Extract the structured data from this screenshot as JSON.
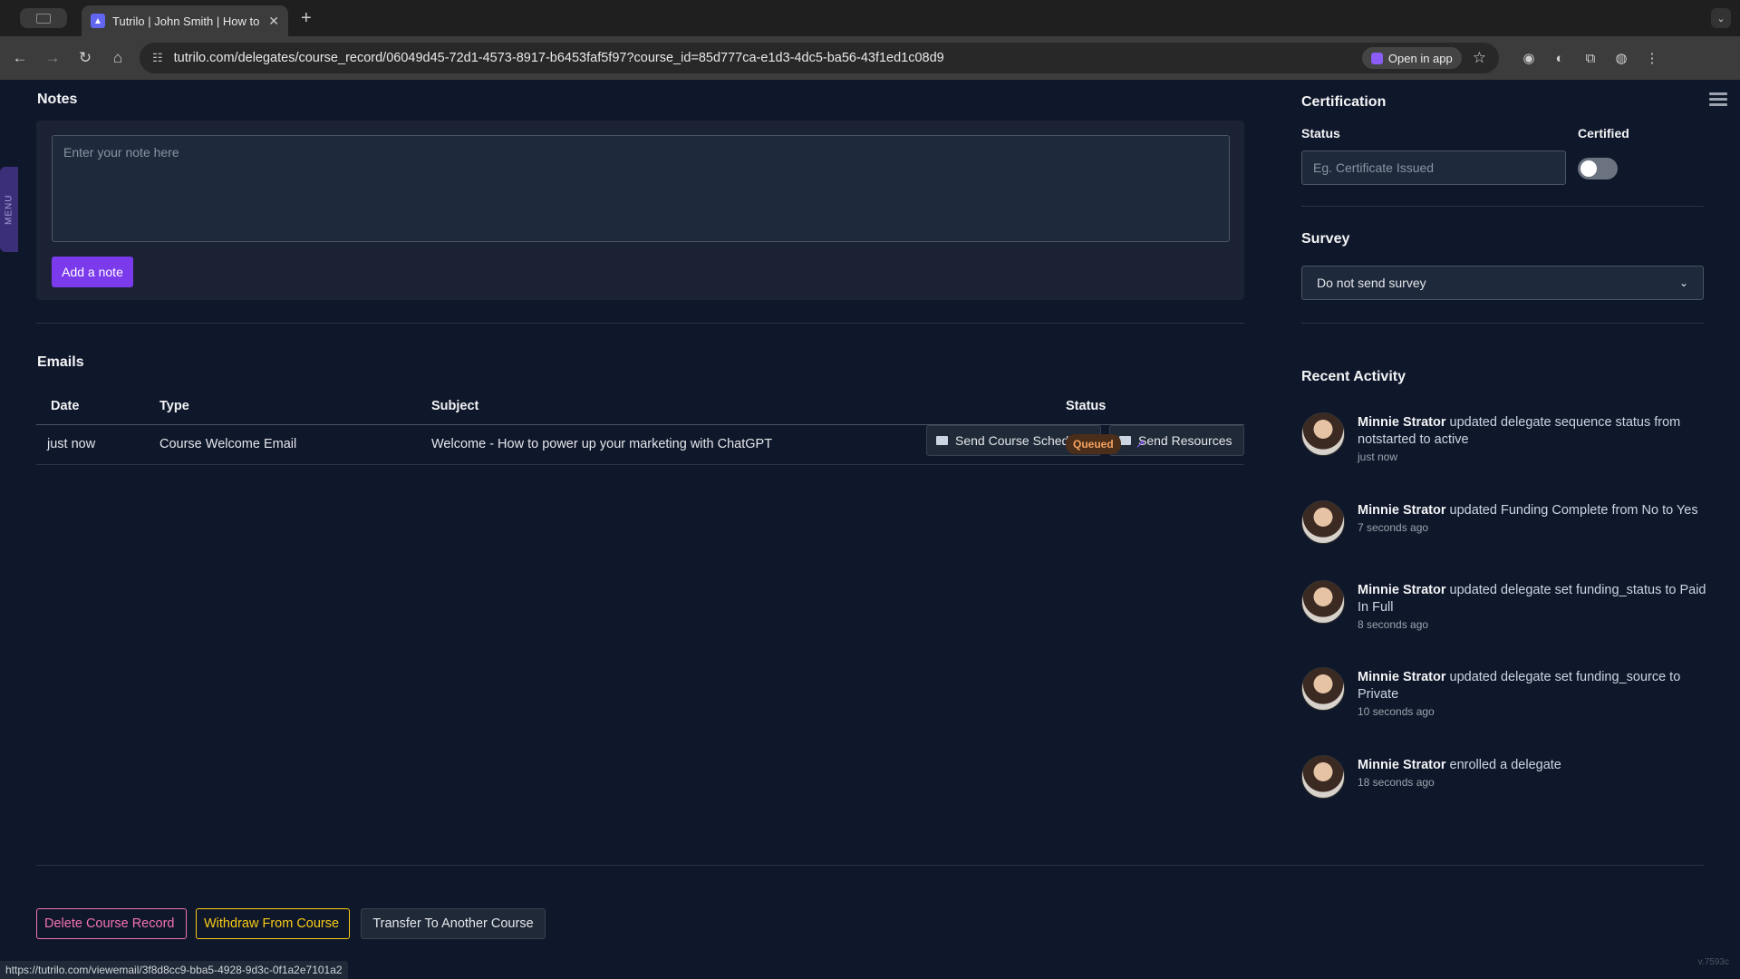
{
  "browser": {
    "tab_title": "Tutrilo | John Smith | How to p",
    "url": "tutrilo.com/delegates/course_record/06049d45-72d1-4573-8917-b6453faf5f97?course_id=85d777ca-e1d3-4dc5-ba56-43f1ed1c08d9",
    "open_in_app": "Open in app",
    "status_url": "https://tutrilo.com/viewemail/3f8d8cc9-bba5-4928-9d3c-0f1a2e7101a2"
  },
  "menu_tab": "MENU",
  "notes": {
    "title": "Notes",
    "placeholder": "Enter your note here",
    "add_button": "Add a note"
  },
  "emails": {
    "title": "Emails",
    "send_schedule": "Send Course Schedule",
    "send_resources": "Send Resources",
    "headers": [
      "Date",
      "Type",
      "Subject",
      "Status"
    ],
    "rows": [
      {
        "date": "just now",
        "type": "Course Welcome Email",
        "subject": "Welcome - How to power up your marketing with ChatGPT",
        "status": "Queued"
      }
    ]
  },
  "actions": {
    "delete": "Delete Course Record",
    "withdraw": "Withdraw From Course",
    "transfer": "Transfer To Another Course"
  },
  "certification": {
    "title": "Certification",
    "status_label": "Status",
    "status_placeholder": "Eg. Certificate Issued",
    "certified_label": "Certified",
    "certified": false
  },
  "survey": {
    "title": "Survey",
    "selected": "Do not send survey"
  },
  "activity": {
    "title": "Recent Activity",
    "items": [
      {
        "who": "Minnie Strator",
        "text": "updated delegate sequence status from notstarted to active",
        "time": "just now"
      },
      {
        "who": "Minnie Strator",
        "text": "updated Funding Complete from No to Yes",
        "time": "7 seconds ago"
      },
      {
        "who": "Minnie Strator",
        "text": "updated delegate set funding_status to Paid In Full",
        "time": "8 seconds ago"
      },
      {
        "who": "Minnie Strator",
        "text": "updated delegate set funding_source to Private",
        "time": "10 seconds ago"
      },
      {
        "who": "Minnie Strator",
        "text": "enrolled a delegate",
        "time": "18 seconds ago"
      }
    ]
  },
  "version": "v.7593c",
  "colors": {
    "background": "#0f172a",
    "accent": "#7c3aed",
    "danger": "#f472b6",
    "warning": "#facc15",
    "queued": "#f4a261"
  }
}
